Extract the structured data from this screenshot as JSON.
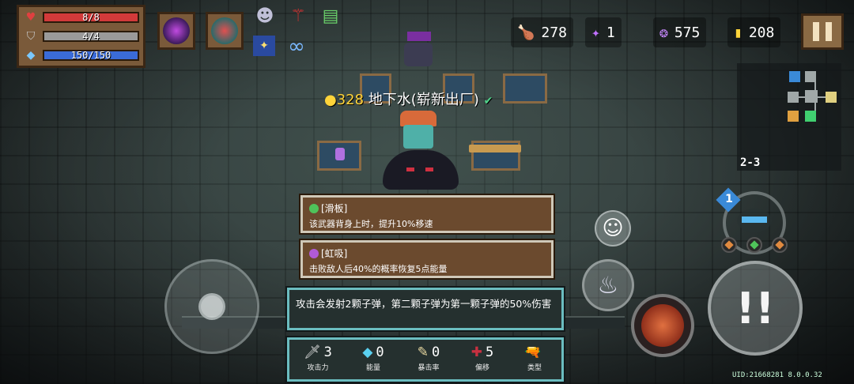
{
  "hud": {
    "health": {
      "text": "8/8",
      "fraction": 1.0,
      "color": "#d23a3a"
    },
    "armor": {
      "text": "4/4",
      "fraction": 1.0,
      "color": "#9a9a9a"
    },
    "energy": {
      "text": "150/150",
      "fraction": 1.0,
      "color": "#3a6bd8"
    },
    "buff_infinity": "∞"
  },
  "resources": {
    "fish": "278",
    "gem": "1",
    "orb": "575",
    "gold": "208"
  },
  "minimap": {
    "level": "2-3"
  },
  "shop": {
    "price": "328",
    "item_name": "地下水(崭新出厂)"
  },
  "tooltips": [
    {
      "title": "[滑板]",
      "text": "该武器背身上时，提升10%移速",
      "gem_color": "#4fc35a"
    },
    {
      "title": "[虹吸]",
      "text": "击败敌人后40%的概率恢复5点能量",
      "gem_color": "#b05ad8"
    }
  ],
  "description": "攻击会发射2颗子弹，第二颗子弹为第一颗子弹的50%伤害",
  "weapon_stats": [
    {
      "icon": "🗡",
      "value": "3",
      "label": "攻击力",
      "color": "#e0e0e0"
    },
    {
      "icon": "◆",
      "value": "0",
      "label": "能量",
      "color": "#5ad0f0"
    },
    {
      "icon": "✎",
      "value": "0",
      "label": "暴击率",
      "color": "#e8d8a0"
    },
    {
      "icon": "✚",
      "value": "5",
      "label": "偏移",
      "color": "#c83040"
    },
    {
      "icon": "🔫",
      "value": "",
      "label": "类型",
      "color": "#4aa8f0"
    }
  ],
  "weapon_swap": {
    "badge": "1"
  },
  "uid": "UID:21668281 8.0.0.32"
}
